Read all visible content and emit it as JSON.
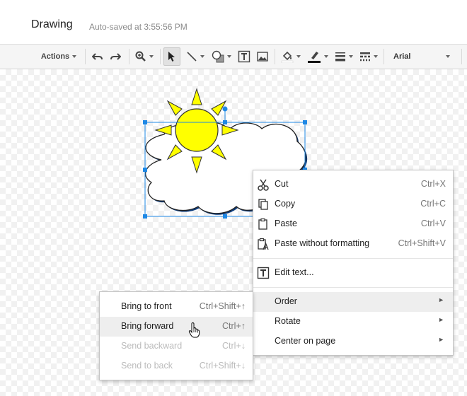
{
  "header": {
    "title": "Drawing",
    "autosave": "Auto-saved at 3:55:56 PM"
  },
  "toolbar": {
    "actions_label": "Actions",
    "font_label": "Arial",
    "icons": [
      "undo-icon",
      "redo-icon",
      "zoom-icon",
      "select-icon",
      "line-icon",
      "shape-icon",
      "textbox-icon",
      "image-icon",
      "fill-color-icon",
      "line-color-icon",
      "line-weight-icon",
      "line-dash-icon"
    ]
  },
  "colors": {
    "selection": "#1e88e5",
    "sun": "#ffff00",
    "menu_highlight": "#eeeeee"
  },
  "context_menu": {
    "items": [
      {
        "label": "Cut",
        "shortcut": "Ctrl+X",
        "icon": "scissors-icon"
      },
      {
        "label": "Copy",
        "shortcut": "Ctrl+C",
        "icon": "copy-icon"
      },
      {
        "label": "Paste",
        "shortcut": "Ctrl+V",
        "icon": "paste-icon"
      },
      {
        "label": "Paste without formatting",
        "shortcut": "Ctrl+Shift+V",
        "icon": "paste-plain-icon"
      },
      {
        "label": "Edit text...",
        "icon": "text-icon"
      },
      {
        "label": "Order",
        "arrow": "►"
      },
      {
        "label": "Rotate",
        "arrow": "►"
      },
      {
        "label": "Center on page",
        "arrow": "►"
      }
    ]
  },
  "order_submenu": {
    "items": [
      {
        "label": "Bring to front",
        "shortcut": "Ctrl+Shift+↑",
        "enabled": true
      },
      {
        "label": "Bring forward",
        "shortcut": "Ctrl+↑",
        "enabled": true
      },
      {
        "label": "Send backward",
        "shortcut": "Ctrl+↓",
        "enabled": false
      },
      {
        "label": "Send to back",
        "shortcut": "Ctrl+Shift+↓",
        "enabled": false
      }
    ]
  }
}
